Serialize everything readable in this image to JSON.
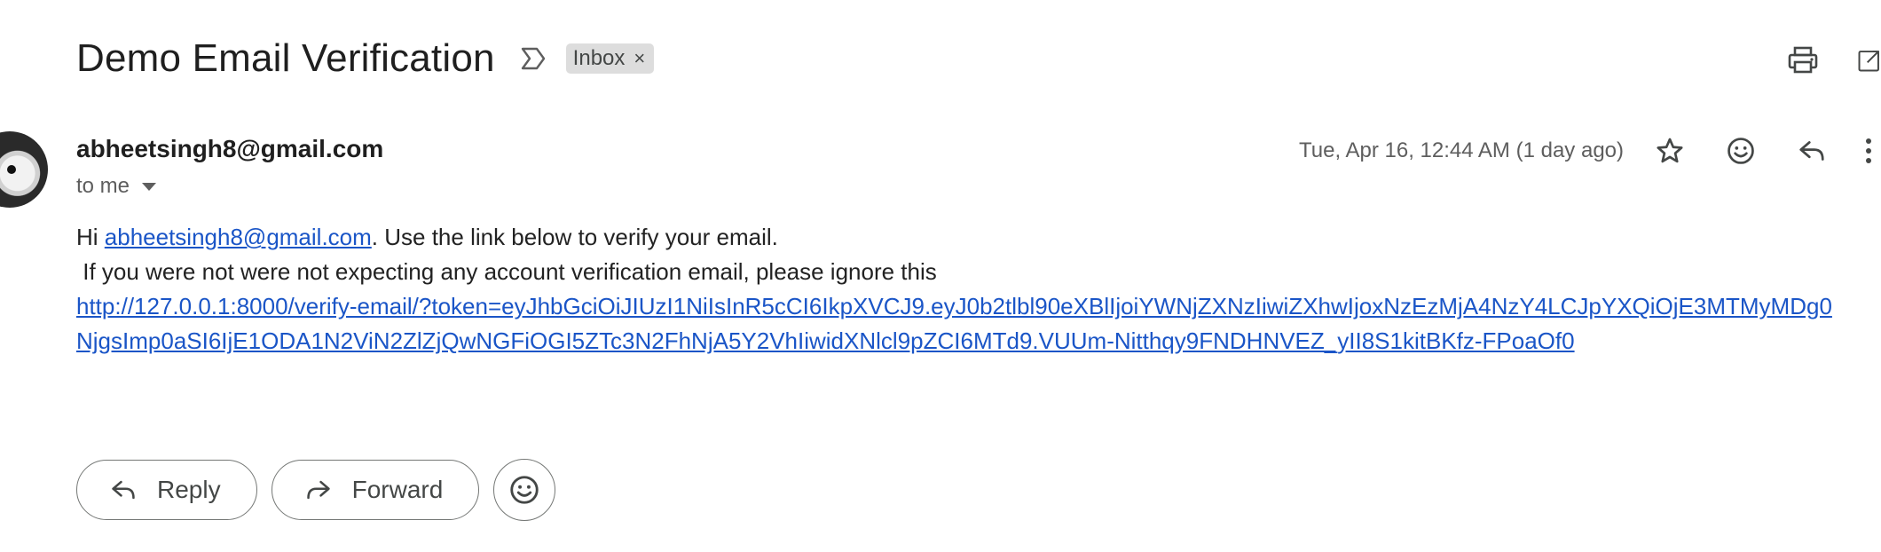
{
  "email": {
    "subject": "Demo Email Verification",
    "label": "Inbox",
    "label_remove": "×",
    "sender": "abheetsingh8@gmail.com",
    "recipient": "to me",
    "date": "Tue, Apr 16, 12:44 AM (1 day ago)",
    "body": {
      "greeting_prefix": "Hi ",
      "greeting_email": "abheetsingh8@gmail.com",
      "greeting_suffix": ". Use the link below to verify your email.",
      "line2": " If you were not were not expecting any account verification email, please ignore this",
      "link": "http://127.0.0.1:8000/verify-email/?token=eyJhbGciOiJIUzI1NiIsInR5cCI6IkpXVCJ9.eyJ0b2tlbl90eXBlIjoiYWNjZXNzIiwiZXhwIjoxNzEzMjA4NzY4LCJpYXQiOjE3MTMyMDg0NjgsImp0aSI6IjE1ODA1N2ViN2ZlZjQwNGFiOGI5ZTc3N2FhNjA5Y2VhIiwidXNlcl9pZCI6MTd9.VUUm-Nitthqy9FNDHNVEZ_yII8S1kitBKfz-FPoaOf0"
    }
  },
  "actions": {
    "reply_label": "Reply",
    "forward_label": "Forward"
  },
  "icons": {
    "importance": "importance-marker-icon",
    "print": "print-icon",
    "open_new_window": "open-in-new-window-icon",
    "star": "star-icon",
    "emoji": "emoji-icon",
    "reply": "reply-icon",
    "more": "more-vert-icon",
    "forward": "forward-icon"
  },
  "colors": {
    "link": "#1a55c7",
    "chip_bg": "#dddddd",
    "muted_text": "#5e5e5e"
  }
}
